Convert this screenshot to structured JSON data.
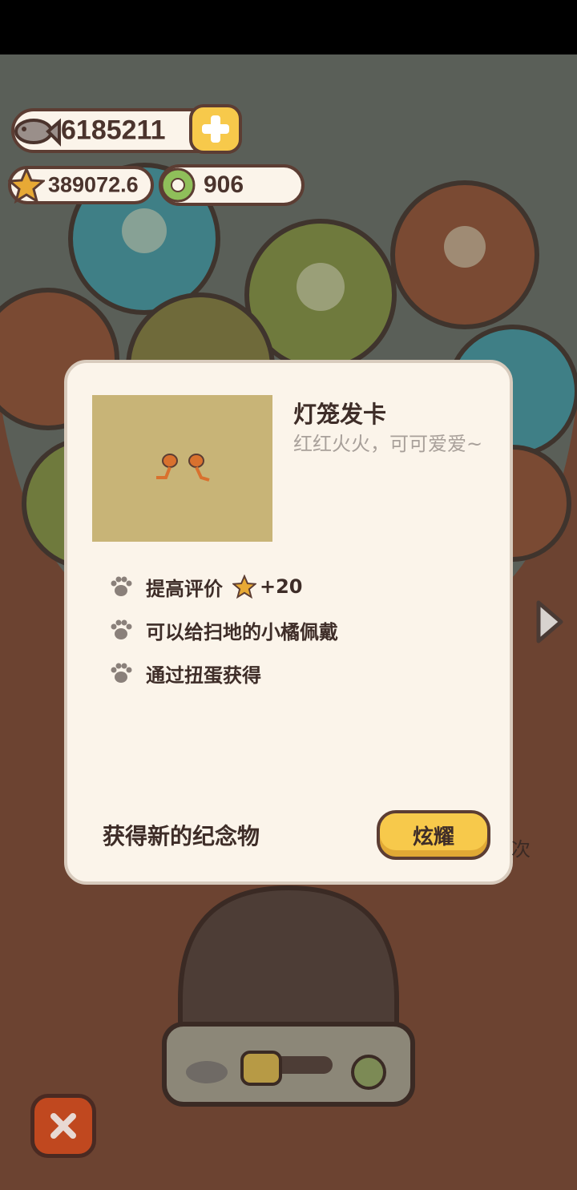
{
  "currency": {
    "fish": "6185211",
    "stars": "389072.6",
    "rings": "906"
  },
  "item": {
    "title": "灯笼发卡",
    "subtitle": "红红火火，可可爱爱~",
    "features": [
      {
        "text": "提高评价",
        "bonus": "+20"
      },
      {
        "text": "可以给扫地的小橘佩戴"
      },
      {
        "text": "通过扭蛋获得"
      }
    ]
  },
  "footer": {
    "label": "获得新的纪念物",
    "show_button": "炫耀"
  },
  "background": {
    "side_text": "次"
  },
  "icons": {
    "fish": "fish-icon",
    "star": "star-icon",
    "ring": "ring-icon",
    "plus": "plus-icon",
    "paw": "paw-icon",
    "close": "close-icon",
    "arrow": "chevron-right-icon",
    "lantern": "lantern-hairpin-icon"
  },
  "colors": {
    "accent_yellow": "#f7c94b",
    "close_red": "#c0481f",
    "card_bg": "#fbf4ea",
    "text_dark": "#3e2d28"
  }
}
